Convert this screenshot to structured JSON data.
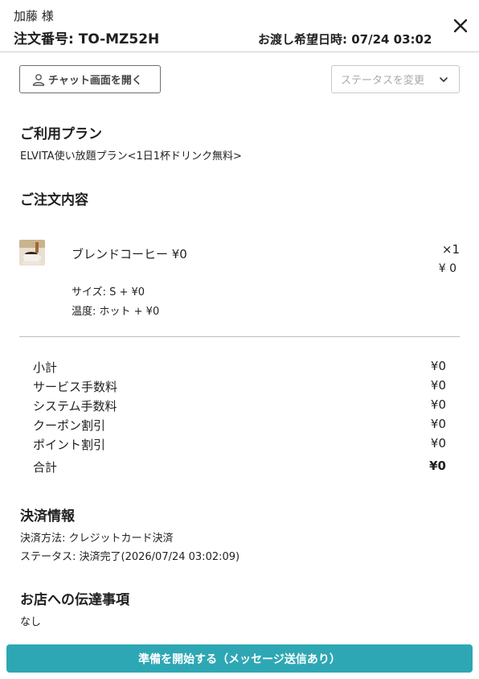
{
  "header": {
    "customer": "加藤 様",
    "order_number": "注文番号: TO-MZ52H",
    "handover": "お渡し希望日時: 07/24 03:02"
  },
  "actions": {
    "chat_label": "チャット画面を開く",
    "status_placeholder": "ステータスを変更"
  },
  "plan": {
    "title": "ご利用プラン",
    "name": "ELVITA使い放題プラン<1日1杯ドリンク無料>"
  },
  "order": {
    "title": "ご注文内容",
    "items": [
      {
        "name": "ブレンドコーヒー ¥0",
        "qty": "×1",
        "price": "¥ 0",
        "options": [
          "サイズ: S + ¥0",
          "温度: ホット + ¥0"
        ]
      }
    ]
  },
  "summary": {
    "rows": [
      {
        "label": "小計",
        "value": "¥0"
      },
      {
        "label": "サービス手数料",
        "value": "¥0"
      },
      {
        "label": "システム手数料",
        "value": "¥0"
      },
      {
        "label": "クーポン割引",
        "value": "¥0"
      },
      {
        "label": "ポイント割引",
        "value": "¥0"
      }
    ],
    "total_label": "合計",
    "total_value": "¥0"
  },
  "payment": {
    "title": "決済情報",
    "method": "決済方法: クレジットカード決済",
    "status": "ステータス: 決済完了(2026/07/24 03:02:09)"
  },
  "notes": {
    "title": "お店への伝達事項",
    "text": "なし"
  },
  "footer": {
    "start_label": "準備を開始する（メッセージ送信あり）"
  },
  "colors": {
    "primary": "#2ea7b4",
    "divider": "#cfcfcf"
  }
}
